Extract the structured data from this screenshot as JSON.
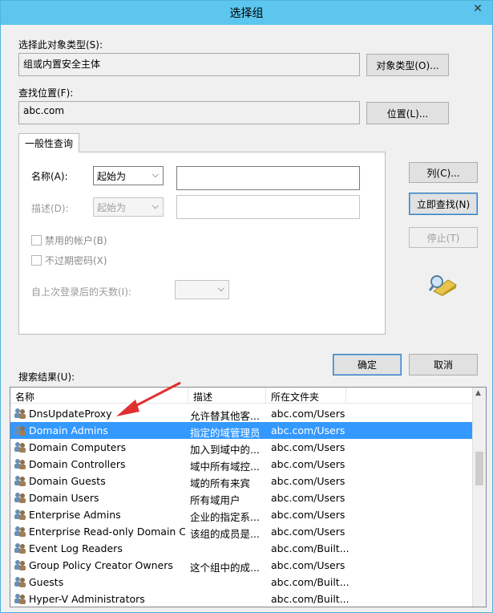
{
  "window": {
    "title": "选择组",
    "close_label": "✕"
  },
  "object_type": {
    "label": "选择此对象类型(S):",
    "value": "组或内置安全主体",
    "button": "对象类型(O)..."
  },
  "location": {
    "label": "查找位置(F):",
    "value": "abc.com",
    "button": "位置(L)..."
  },
  "query": {
    "tab_label": "一般性查询",
    "name_label": "名称(A):",
    "name_mode": "起始为",
    "desc_label": "描述(D):",
    "desc_mode": "起始为",
    "disabled_accounts": "禁用的帐户(B)",
    "non_expiring_pw": "不过期密码(X)",
    "days_since_logon": "自上次登录后的天数(I):"
  },
  "buttons": {
    "columns": "列(C)...",
    "find_now": "立即查找(N)",
    "stop": "停止(T)",
    "ok": "确定",
    "cancel": "取消"
  },
  "results": {
    "label": "搜索结果(U):",
    "columns": [
      "名称",
      "描述",
      "所在文件夹"
    ],
    "rows": [
      {
        "name": "DnsUpdateProxy",
        "desc": "允许替其他客...",
        "folder": "abc.com/Users",
        "selected": false
      },
      {
        "name": "Domain Admins",
        "desc": "指定的域管理员",
        "folder": "abc.com/Users",
        "selected": true
      },
      {
        "name": "Domain Computers",
        "desc": "加入到域中的...",
        "folder": "abc.com/Users",
        "selected": false
      },
      {
        "name": "Domain Controllers",
        "desc": "域中所有域控...",
        "folder": "abc.com/Users",
        "selected": false
      },
      {
        "name": "Domain Guests",
        "desc": "域的所有来宾",
        "folder": "abc.com/Users",
        "selected": false
      },
      {
        "name": "Domain Users",
        "desc": "所有域用户",
        "folder": "abc.com/Users",
        "selected": false
      },
      {
        "name": "Enterprise Admins",
        "desc": "企业的指定系...",
        "folder": "abc.com/Users",
        "selected": false
      },
      {
        "name": "Enterprise Read-only Domain C...",
        "desc": "该组的成员是...",
        "folder": "abc.com/Users",
        "selected": false
      },
      {
        "name": "Event Log Readers",
        "desc": "",
        "folder": "abc.com/Built...",
        "selected": false
      },
      {
        "name": "Group Policy Creator Owners",
        "desc": "这个组中的成...",
        "folder": "abc.com/Users",
        "selected": false
      },
      {
        "name": "Guests",
        "desc": "",
        "folder": "abc.com/Built...",
        "selected": false
      },
      {
        "name": "Hyper-V Administrators",
        "desc": "",
        "folder": "abc.com/Built...",
        "selected": false
      }
    ]
  },
  "colors": {
    "titlebar": "#5cc6ee",
    "selection": "#3399ff",
    "annotation_arrow": "#e03030"
  },
  "icons": {
    "group": "group-icon",
    "search": "search-flashlight-icon"
  }
}
